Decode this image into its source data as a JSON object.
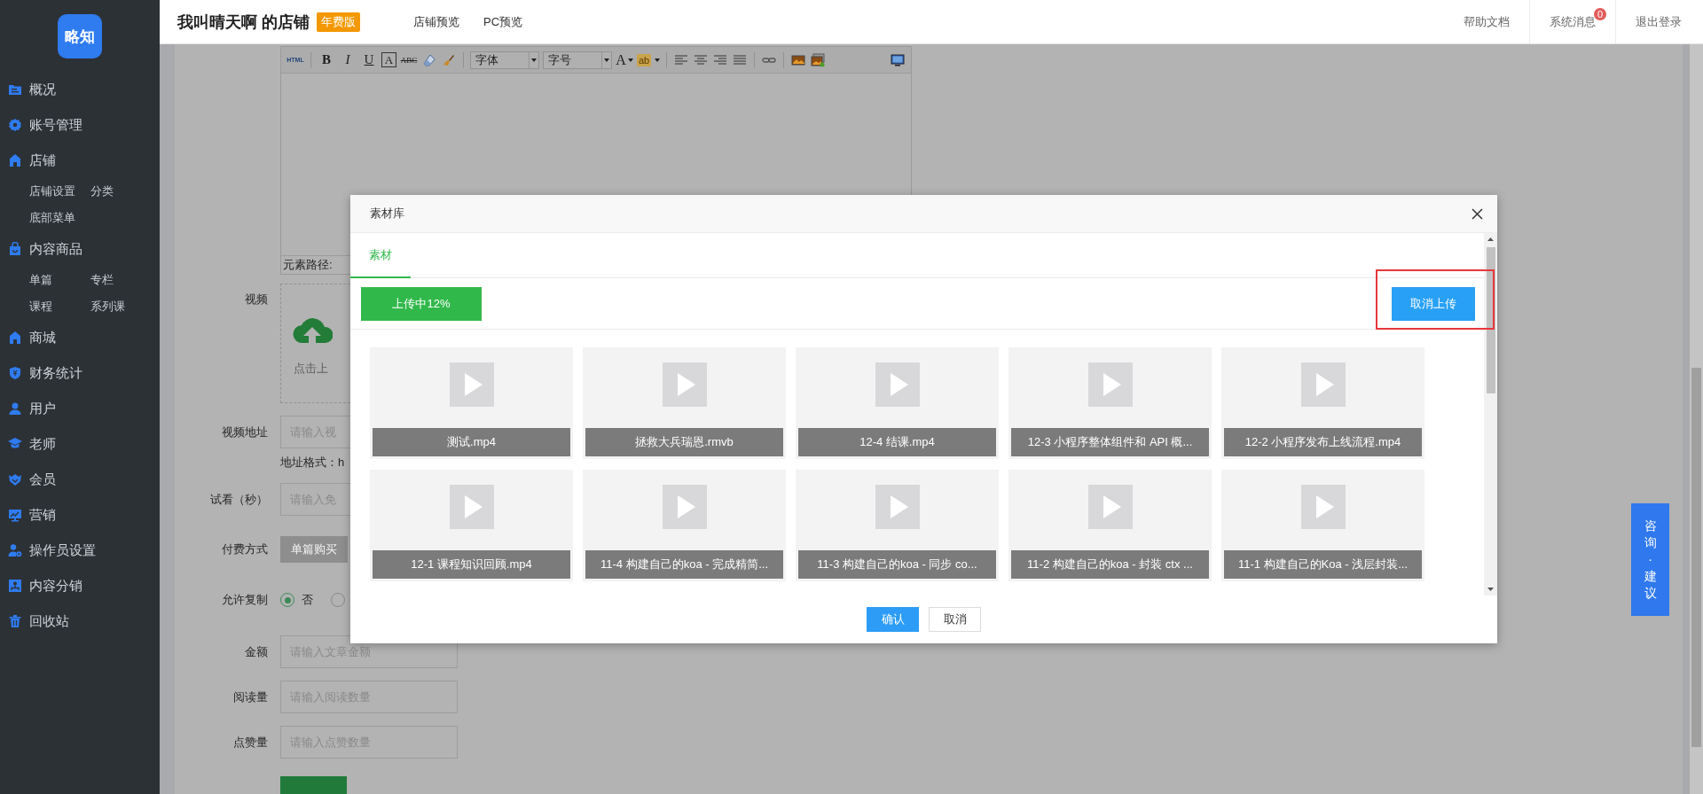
{
  "sidebar": {
    "logo": "略知",
    "items": [
      {
        "label": "概况"
      },
      {
        "label": "账号管理"
      },
      {
        "label": "店铺",
        "children": [
          {
            "label": "店铺设置"
          },
          {
            "label": "分类"
          },
          {
            "label": "底部菜单"
          }
        ]
      },
      {
        "label": "内容商品",
        "children": [
          {
            "label": "单篇"
          },
          {
            "label": "专栏"
          },
          {
            "label": "课程"
          },
          {
            "label": "系列课"
          }
        ]
      },
      {
        "label": "商城"
      },
      {
        "label": "财务统计"
      },
      {
        "label": "用户"
      },
      {
        "label": "老师"
      },
      {
        "label": "会员"
      },
      {
        "label": "营销"
      },
      {
        "label": "操作员设置"
      },
      {
        "label": "内容分销"
      },
      {
        "label": "回收站"
      }
    ]
  },
  "topbar": {
    "shop_name": "我叫晴天啊 的店铺",
    "plan_badge": "年费版",
    "links": [
      "店铺预览",
      "PC预览"
    ],
    "actions": [
      {
        "label": "帮助文档"
      },
      {
        "label": "系统消息",
        "badge": "0"
      },
      {
        "label": "退出登录"
      }
    ]
  },
  "editor": {
    "toolbar_groups": [
      [
        {
          "kind": "html",
          "label": "HTML"
        }
      ],
      [
        {
          "kind": "bold",
          "label": "B"
        },
        {
          "kind": "italic",
          "label": "I"
        },
        {
          "kind": "underline",
          "label": "U"
        },
        {
          "kind": "boxed",
          "label": "A"
        },
        {
          "kind": "strike",
          "label": "ABC"
        },
        {
          "kind": "icon"
        },
        {
          "kind": "icon"
        }
      ],
      [
        {
          "kind": "select",
          "label": "字体"
        },
        {
          "kind": "select",
          "label": "字号"
        },
        {
          "kind": "color",
          "label": "A"
        },
        {
          "kind": "highlight",
          "label": "ab"
        }
      ],
      [
        {
          "kind": "icon"
        },
        {
          "kind": "icon"
        },
        {
          "kind": "icon"
        },
        {
          "kind": "icon"
        }
      ],
      [
        {
          "kind": "icon"
        }
      ],
      [
        {
          "kind": "icon"
        },
        {
          "kind": "icon"
        }
      ],
      [
        {
          "kind": "icon"
        }
      ]
    ],
    "path_label": "元素路径:"
  },
  "form": {
    "rows": [
      {
        "kind": "upload",
        "label": "视频",
        "text": "点击上"
      },
      {
        "kind": "input",
        "label": "视频地址",
        "placeholder": "请输入视",
        "hint": "地址格式：h"
      },
      {
        "kind": "input",
        "label": "试看（秒）",
        "placeholder": "请输入免"
      },
      {
        "kind": "segmented",
        "label": "付费方式",
        "options": [
          {
            "label": "单篇购买",
            "selected": true
          }
        ]
      },
      {
        "kind": "radio",
        "label": "允许复制",
        "options": [
          {
            "label": "否",
            "selected": true
          },
          {
            "selected": false
          }
        ]
      },
      {
        "kind": "input",
        "label": "金额",
        "placeholder": "请输入文章金额"
      },
      {
        "kind": "input",
        "label": "阅读量",
        "placeholder": "请输入阅读数量"
      },
      {
        "kind": "input",
        "label": "点赞量",
        "placeholder": "请输入点赞数量"
      }
    ]
  },
  "dialog": {
    "title": "素材库",
    "tabs": [
      {
        "label": "素材",
        "selected": true
      }
    ],
    "upload_button": {
      "label": "上传中12%"
    },
    "cancel_upload": {
      "label": "取消上传",
      "highlighted": true
    },
    "files": [
      {
        "name": "测试.mp4"
      },
      {
        "name": "拯救大兵瑞恩.rmvb"
      },
      {
        "name": "12-4 结课.mp4"
      },
      {
        "name": "12-3 小程序整体组件和 API 概..."
      },
      {
        "name": "12-2 小程序发布上线流程.mp4"
      },
      {
        "name": "12-1 课程知识回顾.mp4"
      },
      {
        "name": "11-4 构建自己的koa - 完成精简..."
      },
      {
        "name": "11-3 构建自己的koa - 同步 co..."
      },
      {
        "name": "11-2 构建自己的koa - 封装 ctx ..."
      },
      {
        "name": "11-1 构建自己的Koa - 浅层封装..."
      }
    ],
    "buttons": [
      {
        "kind": "primary",
        "label": "确认"
      },
      {
        "kind": "default",
        "label": "取消"
      }
    ]
  },
  "feedback": {
    "label": "咨询·建议"
  }
}
